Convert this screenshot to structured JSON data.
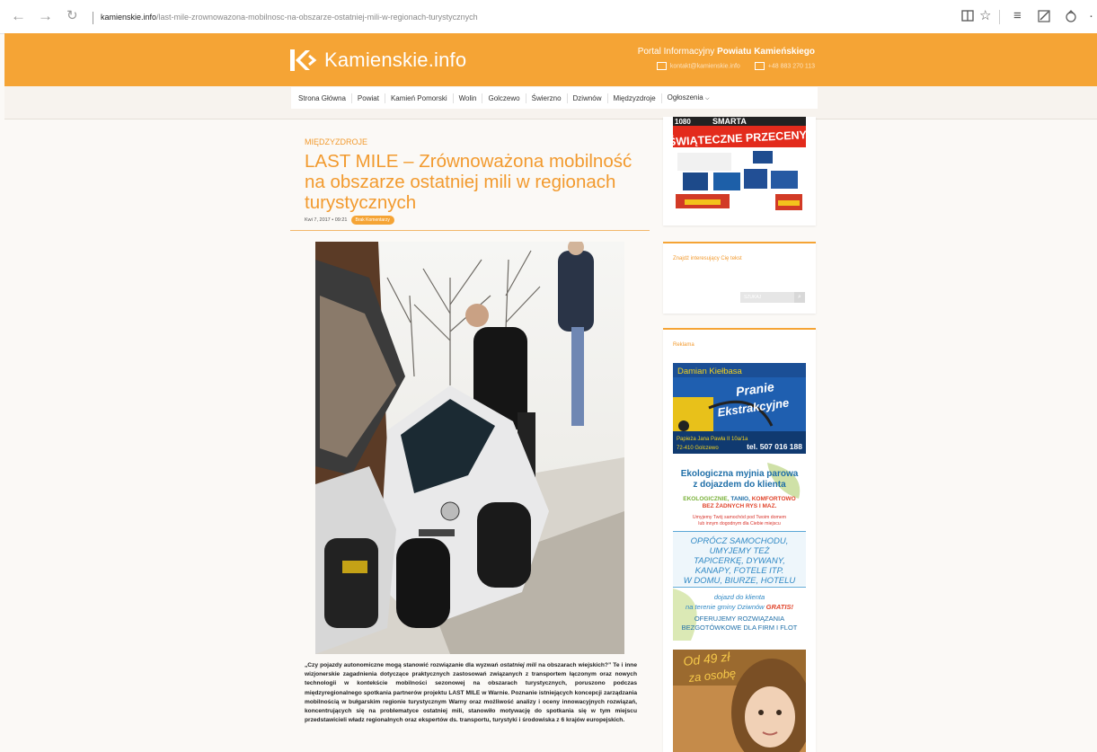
{
  "browser": {
    "url_host": "kamienskie.info",
    "url_path": "/last-mile-zrownowazona-mobilnosc-na-obszarze-ostatniej-mili-w-regionach-turystycznych",
    "back_icon": "arrow-left-icon",
    "forward_icon": "arrow-right-icon",
    "refresh_icon": "refresh-icon"
  },
  "header": {
    "site_name": "Kamienskie.info",
    "portal_prefix": "Portal Informacyjny ",
    "portal_bold": "Powiatu Kamieńskiego",
    "email": "kontakt@kamienskie.info",
    "phone": "+48 883 270 113",
    "accent_color": "#f5a435"
  },
  "nav": {
    "items": [
      "Strona Główna",
      "Powiat",
      "Kamień Pomorski",
      "Wolin",
      "Golczewo",
      "Świerzno",
      "Dziwnów",
      "Międzyzdroje",
      "Ogłoszenia"
    ]
  },
  "article": {
    "category": "MIĘDZYZDROJE",
    "title": "LAST MILE – Zrównoważona mobilność na obszarze ostatniej mili w regionach turystycznych",
    "date": "Kwi 7, 2017 • 09:21",
    "comments": "Brak Komentarzy",
    "p_open": "„Czy pojazdy autonomiczne mogą stanowić rozwiązanie dla wyzwań ",
    "p_em": "ostatniej mili",
    "p_rest": " na obszarach wiejskich?” Te i inne wizjonerskie zagadnienia dotyczące praktycznych zastosowań związanych z transportem łączonym oraz nowych technologii w kontekście mobilności sezonowej na obszarach turystycznych, poruszono podczas międzyregionalnego spotkania partnerów projektu LAST MILE w Warnie. Poznanie istniejących koncepcji zarządzania mobilnością w bułgarskim regionie turystycznym Warny oraz możliwość analizy i oceny innowacyjnych rozwiązań, koncentrujących się na problematyce ostatniej mili, stanowiło motywację do spotkania się w tym miejscu przedstawicieli władz regionalnych oraz ekspertów ds. transportu, turystyki i środowiska z 6 krajów europejskich."
  },
  "sidebar": {
    "promo_1080": "1080",
    "promo_brand": "SMARTA",
    "promo_text": "ŚWIĄTECZNE PRZECENY!",
    "search_title": "Znajdź interesujący Cię tekst",
    "search_placeholder": "SZUKAJ",
    "ads_title": "Reklama",
    "ad1_name": "Damian Kiełbasa",
    "ad1_word1": "Pranie",
    "ad1_word2": "Ekstrakcyjne",
    "ad1_address": "Papieża Jana Pawła II 10a/1a",
    "ad1_city": "72-410 Golczewo",
    "ad1_phone": "tel. 507 016 188",
    "ad2_title_1": "Ekologiczna myjnia parowa",
    "ad2_title_2": "z dojazdem do klienta",
    "ad2_tag_green": "EKOLOGICZNIE, ",
    "ad2_tag_blue": "TANIO, ",
    "ad2_tag_orange": "KOMFORTOWO",
    "ad2_tag_2": "BEZ ŻADNYCH RYS I MAZ.",
    "ad2_red_1": "Umyjemy Twój samochód pod Twoim domem",
    "ad2_red_2": "lub innym dogodnym dla Ciebie miejscu",
    "ad2_blue_1": "OPRÓCZ SAMOCHODU,",
    "ad2_blue_2": "UMYJEMY TEŻ",
    "ad2_blue_3": "TAPICERKĘ, DYWANY,",
    "ad2_blue_4": "KANAPY, FOTELE ITP.",
    "ad2_blue_5": "W DOMU, BIURZE, HOTELU",
    "ad2_free_1": "dojazd do klienta",
    "ad2_free_2": "na terenie gminy Dziwnów ",
    "ad2_free_3": "GRATIS!",
    "ad2_pay_1": "OFERUJEMY ROZWIĄZANIA",
    "ad2_pay_2": "BEZGOTÓWKOWE DLA FIRM I FLOT",
    "ad3_price_1": "Od 49 zł",
    "ad3_price_2": "za osobę"
  }
}
